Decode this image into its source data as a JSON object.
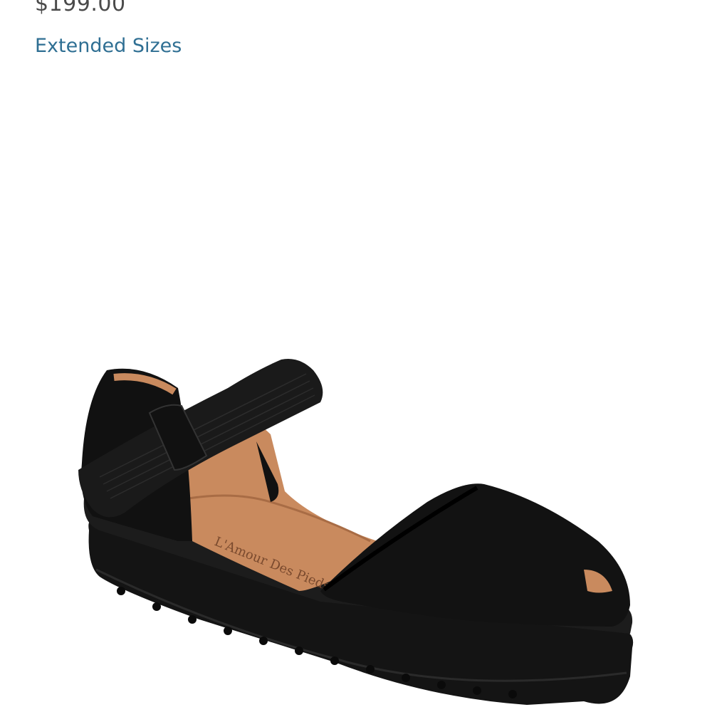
{
  "product": {
    "price": "$199.00",
    "extended_sizes_link": "Extended Sizes",
    "image_icon": "black-suede-platform-sandal",
    "insole_brand": "L'Amour Des Pieds"
  },
  "colors": {
    "price_text": "#4a4a4a",
    "link": "#2f6f93",
    "shoe_black": "#111111",
    "leather_tan": "#c98a5e"
  }
}
